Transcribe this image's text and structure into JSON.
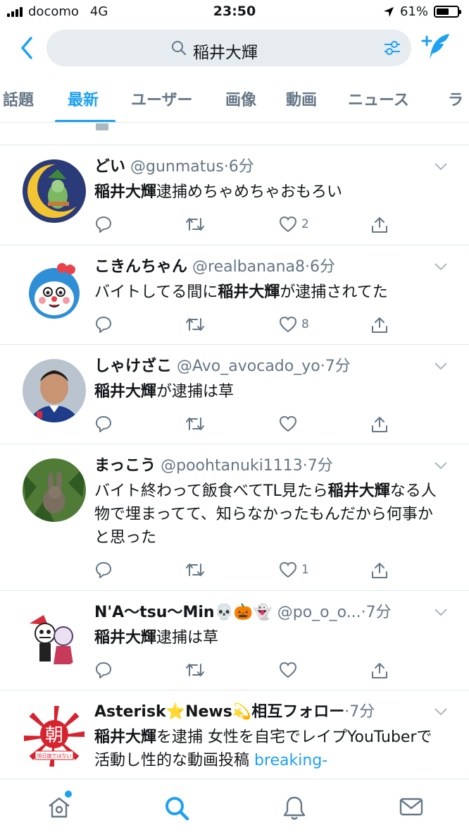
{
  "status_bar": {
    "carrier": "docomo",
    "network": "4G",
    "time": "23:50",
    "battery": "61%",
    "battery_level": 0.61
  },
  "header": {
    "search_query": "稲井大輝"
  },
  "tabs": [
    {
      "label": "話題"
    },
    {
      "label": "最新"
    },
    {
      "label": "ユーザー"
    },
    {
      "label": "画像"
    },
    {
      "label": "動画"
    },
    {
      "label": "ニュース"
    },
    {
      "label": "ラ"
    }
  ],
  "active_tab": "最新",
  "tweets": [
    {
      "name": "どい",
      "handle": "@gunmatus",
      "time": "·6分",
      "body": [
        {
          "b": "稲井大輝"
        },
        {
          "t": "逮捕めちゃめちゃおもろい"
        }
      ],
      "likes": "2"
    },
    {
      "name": "こきんちゃん",
      "handle": "@realbanana8",
      "time": "·6分",
      "body": [
        {
          "t": "バイトしてる間に"
        },
        {
          "b": "稲井大輝"
        },
        {
          "t": "が逮捕されてた"
        }
      ],
      "likes": "8"
    },
    {
      "name": "しゃけざこ",
      "handle": "@Avo_avocado_yo",
      "time": "·7分",
      "body": [
        {
          "b": "稲井大輝"
        },
        {
          "t": "が逮捕は草"
        }
      ],
      "likes": ""
    },
    {
      "name": "まっこう",
      "handle": "@poohtanuki1113",
      "time": "·7分",
      "body": [
        {
          "t": "バイト終わって飯食べてTL見たら"
        },
        {
          "b": "稲井大輝"
        },
        {
          "t": "なる人物で埋まってて、知らなかったもんだから何事かと思った"
        }
      ],
      "likes": "1"
    },
    {
      "name": "N'A〜tsu〜Min💀🎃👻",
      "handle": "@po_o_o...",
      "time": "·7分",
      "body": [
        {
          "b": "稲井大輝"
        },
        {
          "t": "逮捕は草"
        }
      ],
      "likes": ""
    },
    {
      "name": "Asterisk⭐News💫相互フォロー",
      "handle": "",
      "time": "·7分",
      "body": [
        {
          "b": "稲井大輝"
        },
        {
          "t": "を逮捕 女性を自宅でレイプYouTuberで活動し性的な動画投稿 "
        },
        {
          "link": "breaking-"
        }
      ],
      "likes": "",
      "avatar_text": "朝",
      "avatar_caption": "旭日旗ではない"
    }
  ],
  "colors": {
    "accent": "#1da1f2",
    "secondary_text": "#657786",
    "divider": "#e1e8ed"
  },
  "bottom_nav": [
    "home-icon",
    "search-icon",
    "notifications-icon",
    "messages-icon"
  ]
}
